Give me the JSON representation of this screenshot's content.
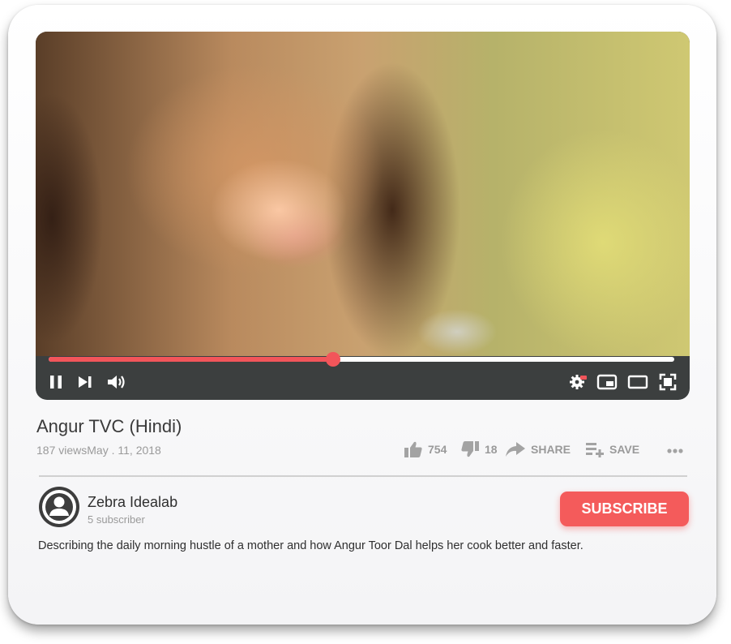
{
  "player": {
    "progress_fraction": 0.455,
    "accent_color": "#f2555a",
    "controls": {
      "play_pause_icon": "pause-icon",
      "next_icon": "skip-next-icon",
      "volume_icon": "volume-icon",
      "settings_icon": "settings-gear-icon",
      "miniplayer_icon": "miniplayer-icon",
      "theater_icon": "theater-mode-icon",
      "fullscreen_icon": "fullscreen-icon"
    }
  },
  "video": {
    "title": "Angur TVC (Hindi)",
    "views": "187 views",
    "date": "May . 11, 2018"
  },
  "actions": {
    "likes": "754",
    "dislikes": "18",
    "share_label": "SHARE",
    "save_label": "SAVE"
  },
  "channel": {
    "name": "Zebra Idealab",
    "subscribers": "5 subscriber",
    "subscribe_label": "SUBSCRIBE",
    "subscribe_color": "#f45b5b"
  },
  "description": "Describing the daily morning hustle of a mother and how Angur Toor Dal helps her cook better and faster."
}
